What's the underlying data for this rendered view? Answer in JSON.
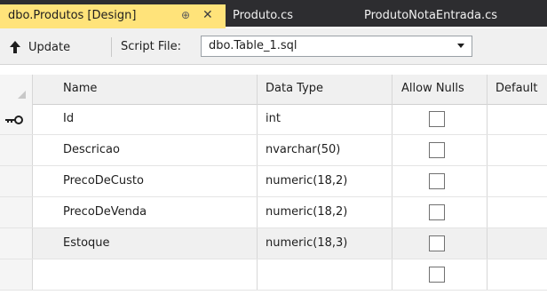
{
  "tabs": [
    {
      "label": "dbo.Produtos [Design]",
      "pin_glyph": "⊕",
      "close_glyph": "✕"
    },
    {
      "label": "Produto.cs"
    },
    {
      "label": "ProdutoNotaEntrada.cs"
    }
  ],
  "toolbar": {
    "update_label": "Update",
    "script_file_label": "Script File:",
    "script_file_value": "dbo.Table_1.sql"
  },
  "grid": {
    "columns": [
      "Name",
      "Data Type",
      "Allow Nulls",
      "Default"
    ],
    "rows": [
      {
        "name": "Id",
        "type": "int",
        "allow_nulls": false,
        "primary_key": true
      },
      {
        "name": "Descricao",
        "type": "nvarchar(50)",
        "allow_nulls": false
      },
      {
        "name": "PrecoDeCusto",
        "type": "numeric(18,2)",
        "allow_nulls": false
      },
      {
        "name": "PrecoDeVenda",
        "type": "numeric(18,2)",
        "allow_nulls": false
      },
      {
        "name": "Estoque",
        "type": "numeric(18,3)",
        "allow_nulls": false,
        "selected": true
      },
      {
        "name": "",
        "type": "",
        "allow_nulls": false
      }
    ]
  },
  "icons": {
    "update": "up-arrow-icon",
    "primary_key": "key-icon"
  },
  "colors": {
    "active_tab": "#ffe37a",
    "tab_strip": "#2d2d30"
  }
}
